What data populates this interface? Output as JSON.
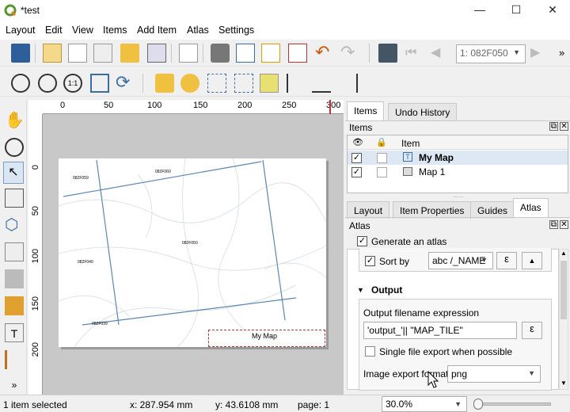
{
  "window": {
    "title": "*test",
    "minimize": "—",
    "maximize": "☐",
    "close": "✕"
  },
  "menu": [
    "Layout",
    "Edit",
    "View",
    "Items",
    "Add Item",
    "Atlas",
    "Settings"
  ],
  "toolbar": {
    "atlas_page": "1: 082F050",
    "overflow": "»"
  },
  "ruler": {
    "h_ticks": [
      "0",
      "50",
      "100",
      "150",
      "200",
      "250",
      "300"
    ],
    "v_ticks": [
      "0",
      "50",
      "100",
      "150",
      "200"
    ]
  },
  "map": {
    "labels": [
      "082F059",
      "082F060",
      "082F040",
      "082F050",
      "082F039"
    ],
    "title_item": "My Map"
  },
  "panel": {
    "tabs_top": [
      "Items",
      "Undo History"
    ],
    "items_header": "Items",
    "items_col": "Item",
    "items": [
      {
        "name": "My Map",
        "visible": "✓"
      },
      {
        "name": "Map 1",
        "visible": "✓"
      }
    ],
    "tabs_bottom": [
      "Layout",
      "Item Properties",
      "Guides",
      "Atlas"
    ],
    "atlas_header": "Atlas",
    "generate_label": "Generate an atlas",
    "sort_by_label": "Sort by",
    "sort_field": "abc /_NAME",
    "epsilon": "ε",
    "up": "▲",
    "output_header": "Output",
    "output_expr_label": "Output filename expression",
    "output_expr": "'output_'|| \"MAP_TILE\"",
    "single_file_label": "Single file export when possible",
    "image_format_label": "Image export format",
    "image_format": "png"
  },
  "status": {
    "selected": "1 item selected",
    "x": "x: 287.954 mm",
    "y": "y: 43.6108 mm",
    "page": "page: 1",
    "zoom": "30.0%"
  },
  "colors": {
    "accent": "#3c6ea6",
    "map_line": "#5a86b8"
  }
}
